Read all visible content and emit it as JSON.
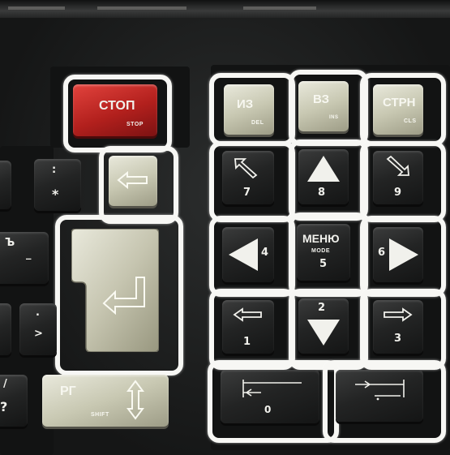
{
  "keys": {
    "stop": {
      "main": "СТОП",
      "sub": "STOP"
    },
    "del": {
      "main": "ИЗ",
      "sub": "DEL"
    },
    "ins": {
      "main": "ВЗ",
      "sub": "INS"
    },
    "cls": {
      "main": "СТРН",
      "sub": "CLS"
    },
    "backspace": {
      "icon": "left-arrow-icon"
    },
    "n7": {
      "digit": "7",
      "icon": "up-left-arrow-icon"
    },
    "n8": {
      "digit": "8",
      "icon": "up-triangle-icon"
    },
    "n9": {
      "digit": "9",
      "icon": "down-right-arrow-icon"
    },
    "n4": {
      "digit": "4",
      "icon": "left-triangle-icon"
    },
    "n5": {
      "main": "МЕНЮ",
      "sub": "MODE",
      "digit": "5"
    },
    "n6": {
      "digit": "6",
      "icon": "right-triangle-icon"
    },
    "n1": {
      "digit": "1",
      "icon": "left-arrow-icon"
    },
    "n2": {
      "digit": "2",
      "icon": "down-triangle-icon"
    },
    "n3": {
      "digit": "3",
      "icon": "right-arrow-icon"
    },
    "n0": {
      "digit": "0",
      "icon": "line-to-start-icon"
    },
    "nend": {
      "icon": "line-to-end-icon"
    },
    "enter": {
      "icon": "enter-arrow-icon"
    },
    "shift": {
      "main": "РГ",
      "sub": "SHIFT",
      "icon": "up-down-arrow-icon"
    },
    "colon": {
      "top": ":",
      "bottom": "*"
    },
    "hard": {
      "top": "Ъ",
      "bottom": "_"
    },
    "greater": {
      "top": ".",
      "bottom": ">"
    },
    "question": {
      "top": "/",
      "bottom": "?"
    }
  },
  "colors": {
    "highlight": "#f7f7f4",
    "stop_key": "#c0261f",
    "light_key": "#c8c8b2",
    "dark_key": "#232424"
  }
}
